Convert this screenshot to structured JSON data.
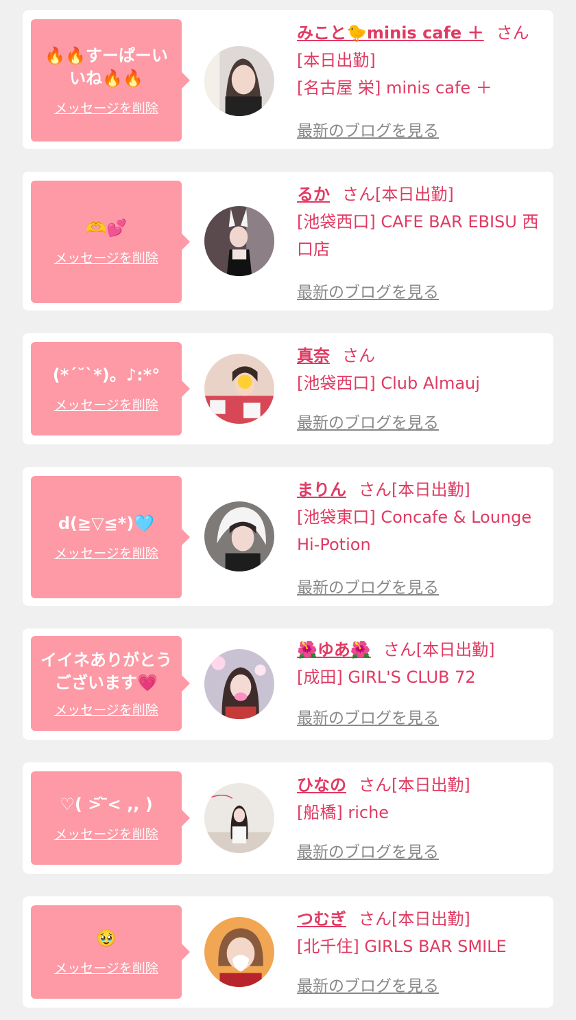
{
  "delete_label": "メッセージを削除",
  "blog_label": "最新のブログを見る",
  "san_suffix": "さん",
  "colors": {
    "background": "#f0f0f0",
    "card": "#ffffff",
    "bubble": "#fd9aa6",
    "accent": "#e03a62",
    "link_gray": "#888888"
  },
  "items": [
    {
      "message": "🔥🔥すーぱーい\nいね🔥🔥",
      "name": "みこと🐤minis cafe ＋",
      "name_suffix": "さん",
      "detail1": "[本日出勤]",
      "detail2": "[名古屋 栄] minis cafe ＋"
    },
    {
      "message": "🫶💕",
      "name": "るか",
      "name_suffix": "さん[本日出勤]",
      "detail1": "[池袋西口] CAFE BAR EBISU 西",
      "detail2": "口店"
    },
    {
      "message": "(*´˘`*)。♪:*°",
      "name": "真奈",
      "name_suffix": "さん",
      "detail1": "[池袋西口] Club Almauj",
      "detail2": ""
    },
    {
      "message": "d(≧▽≦*)🩵",
      "name": "まりん",
      "name_suffix": "さん[本日出勤]",
      "detail1": "[池袋東口] Concafe & Lounge",
      "detail2": "Hi-Potion"
    },
    {
      "message": "イイネありがとう\nございます💗",
      "name": "🌺ゆあ🌺",
      "name_suffix": "さん[本日出勤]",
      "detail1": "[成田] GIRL'S CLUB 72",
      "detail2": ""
    },
    {
      "message": "♡( >᷄ ᷅< ,, )",
      "name": "ひなの",
      "name_suffix": "さん[本日出勤]",
      "detail1": "[船橋] riche",
      "detail2": ""
    },
    {
      "message": "🥹",
      "name": "つむぎ",
      "name_suffix": "さん[本日出勤]",
      "detail1": "[北千住] GIRLS BAR SMILE",
      "detail2": ""
    }
  ]
}
